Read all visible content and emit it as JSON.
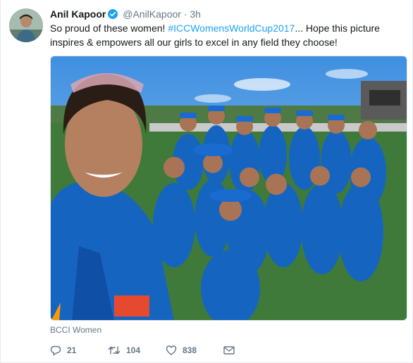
{
  "tweet": {
    "author_name": "Anil Kapoor",
    "handle": "@AnilKapoor",
    "separator": "·",
    "time": "3h",
    "text_prefix": "So proud of these women! ",
    "hashtag": "#ICCWomensWorldCup2017",
    "text_suffix": "... Hope this picture inspires & empowers all our girls to excel in any field they choose!",
    "media_caption": "BCCI Women",
    "replies": "21",
    "retweets": "104",
    "likes": "838"
  },
  "icons": {
    "verified": "verified-badge-icon",
    "reply": "reply-icon",
    "retweet": "retweet-icon",
    "like": "heart-icon",
    "dm": "envelope-icon"
  },
  "colors": {
    "link": "#1da1f2",
    "secondary_text": "#657786",
    "primary_text": "#14171a",
    "team_jersey": "#1565c0"
  }
}
